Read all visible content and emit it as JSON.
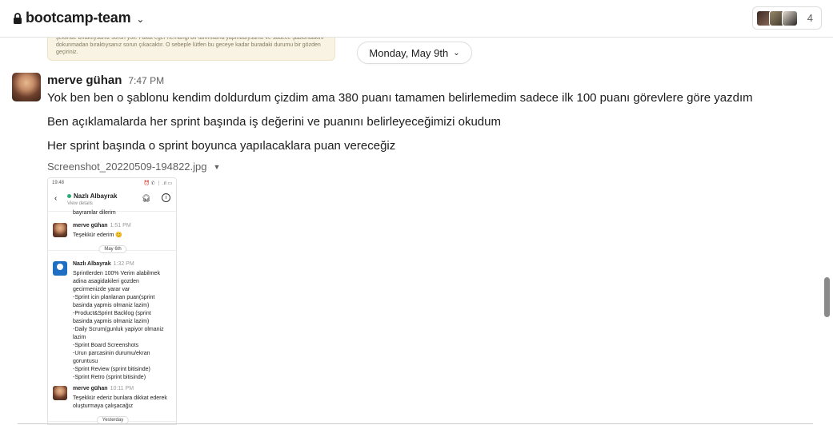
{
  "header": {
    "channel_name": "bootcamp-team",
    "member_count": "4"
  },
  "previous_image_text": "şeklinde bıraktıysanız sorun yok. Fakat eğer herhangi bir tanımlama yapmadıysanız ve sadece şablondakini dokunmadan bıraktıysanız sorun çıkacaktır. O sebeple lütfen bu geceye kadar buradaki durumu bir gözden geçiriniz.",
  "date_divider": "Monday, May 9th",
  "message": {
    "author": "merve gühan",
    "time": "7:47 PM",
    "lines": [
      "Yok ben ben o şablonu kendim doldurdum çizdim ama 380 puanı tamamen belirlemedim sadece ilk 100 puanı görevlere göre yazdım",
      "Ben açıklamalarda her sprint başında iş değerini ve puanını belirleyeceğimizi okudum",
      "Her sprint başında o sprint boyunca yapılacaklara puan vereceğiz"
    ],
    "file_name": "Screenshot_20220509-194822.jpg"
  },
  "phone": {
    "status_time": "19:48",
    "status_right": "⏰ ✆ ⋮ .ıl ▭",
    "contact_name": "Nazlı Albayrak",
    "view_details": "View details",
    "cut_text": "bayramlar dilerim",
    "msg1_author": "merve gühan",
    "msg1_time": "1:51 PM",
    "msg1_text": "Teşekkür ederim 😊",
    "day1": "May 6th",
    "msg2_author": "Nazlı Albayrak",
    "msg2_time": "1:32 PM",
    "msg2_text": "Sprintlerden 100% Verim alabilmek adina asagidakileri gozden gecirmenizde yarar var\n-Sprint icin planlanan puan(sprint basinda yapmis olmaniz lazim)\n-Product&Sprint Backlog (sprint basinda yapmis olmaniz lazim)\n-Daily Scrum(gunluk yapiyor olmaniz lazim\n-Sprint Board Screenshots\n-Urun parcasinin durumu/ekran goruntusu\n-Sprint Review (sprint bitisinde)\n-Sprint Retro (sprint bitisinde)",
    "msg3_author": "merve gühan",
    "msg3_time": "10:11 PM",
    "msg3_text": "Teşekkür ederiz bunlara dikkat ederek oluşturmaya çalışacağız",
    "day2": "Yesterday"
  }
}
